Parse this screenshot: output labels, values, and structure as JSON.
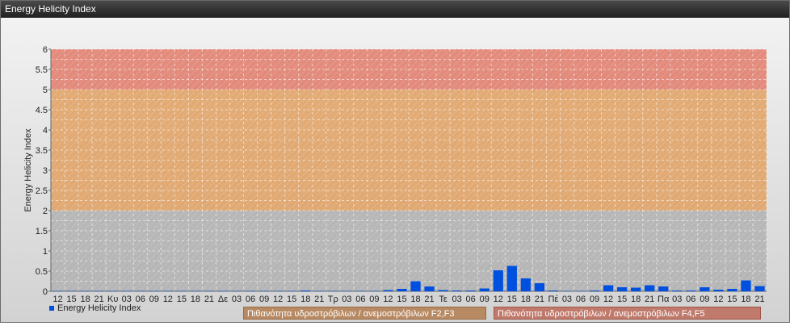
{
  "window": {
    "title": "Energy Helicity Index"
  },
  "legend": {
    "series_label": "Energy Helicity Index",
    "band_f2f3": "Πιθανότητα υδροστρόβιλων / ανεμοστρόβιλων F2,F3",
    "band_f4f5": "Πιθανότητα υδροστρόβιλων / ανεμοστρόβιλων F4,F5"
  },
  "colors": {
    "bar": "#0050e0",
    "band_low": "#b0b0b0",
    "band_mid": "#e0a060",
    "band_high": "#e07a68"
  },
  "chart_data": {
    "type": "bar",
    "ylabel": "Energy Helicity Index",
    "ylim": [
      0,
      6
    ],
    "yticks": [
      "0",
      "0.5",
      "1",
      "1.5",
      "2",
      "2.5",
      "3",
      "3.5",
      "4",
      "4.5",
      "5",
      "5.5",
      "6"
    ],
    "grid": true,
    "bands": [
      {
        "from": 0,
        "to": 2,
        "color": "#b0b0b0"
      },
      {
        "from": 2,
        "to": 5,
        "color": "#e0a060"
      },
      {
        "from": 5,
        "to": 6,
        "color": "#e07a68"
      }
    ],
    "categories": [
      "12",
      "15",
      "18",
      "21",
      "Κυ",
      "03",
      "06",
      "09",
      "12",
      "15",
      "18",
      "21",
      "Δε",
      "03",
      "06",
      "09",
      "12",
      "15",
      "18",
      "21",
      "Τρ",
      "03",
      "06",
      "09",
      "12",
      "15",
      "18",
      "21",
      "Τε",
      "03",
      "06",
      "09",
      "12",
      "15",
      "18",
      "21",
      "Πέ",
      "03",
      "06",
      "09",
      "12",
      "15",
      "18",
      "21",
      "Πα",
      "03",
      "06",
      "09",
      "12",
      "15",
      "18",
      "21"
    ],
    "values": [
      0.01,
      0.01,
      0.01,
      0.01,
      0.01,
      0.01,
      0.01,
      0.01,
      0.01,
      0.01,
      0.01,
      0.01,
      0.01,
      0.01,
      0.01,
      0.01,
      0.01,
      0.01,
      0.02,
      0.01,
      0.01,
      0.01,
      0.01,
      0.01,
      0.03,
      0.06,
      0.25,
      0.12,
      0.03,
      0.02,
      0.02,
      0.07,
      0.52,
      0.63,
      0.32,
      0.2,
      0.02,
      0.01,
      0.01,
      0.02,
      0.15,
      0.1,
      0.09,
      0.15,
      0.12,
      0.02,
      0.02,
      0.1,
      0.04,
      0.06,
      0.27,
      0.13
    ]
  }
}
